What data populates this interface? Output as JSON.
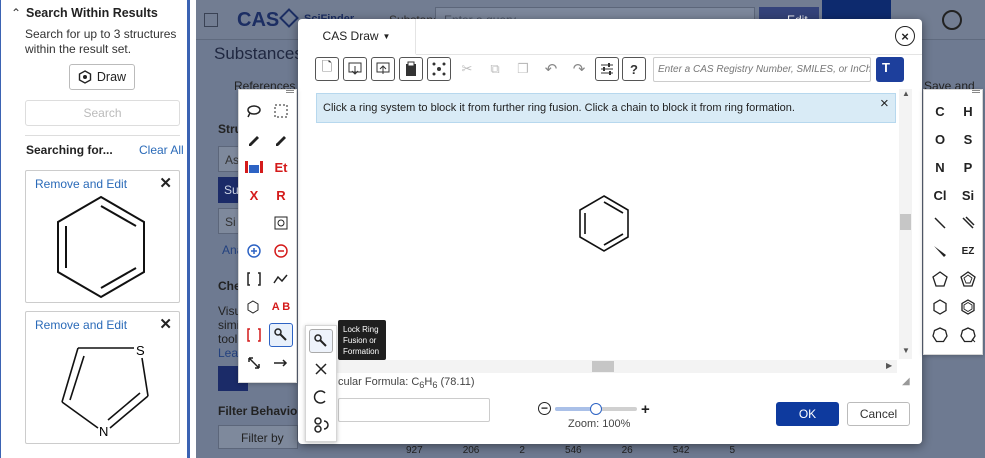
{
  "left": {
    "header": "Search Within Results",
    "desc": "Search for up to 3 structures within the result set.",
    "draw_label": "Draw",
    "search_label": "Search",
    "searching_label": "Searching for...",
    "clear_all": "Clear All",
    "card1_link": "Remove and Edit",
    "card2_link": "Remove and Edit",
    "thiazole_atoms": {
      "s": "S",
      "n": "N"
    }
  },
  "bg": {
    "logo": "CAS",
    "logo_sub": "SciFinder",
    "substances_tab": "Substances",
    "query_placeholder": "Enter a query",
    "edit": "Edit",
    "substance_title": "Substances",
    "references": "References",
    "save_and": "Save and",
    "filter_behavior": "Filter Behavior",
    "filter_by": "Filter by",
    "structure_label": "Stru",
    "che_label": "Che",
    "visu": "Visu",
    "simi": "simi",
    "tool": "tool.",
    "lear": "Lear",
    "ana": "Ana",
    "as": "As",
    "su": "Su",
    "si": "Si",
    "counts": [
      "927",
      "206",
      "2",
      "546",
      "26",
      "542",
      "5"
    ]
  },
  "dialog": {
    "title": "CAS Draw",
    "close": "×",
    "search_placeholder": "Enter a CAS Registry Number, SMILES, or InChI...",
    "info": "Click a ring system to block it from further ring fusion. Click a chain to block it from ring formation.",
    "info_close": "×",
    "formula_label": "cular Formula: C",
    "formula_h": "H",
    "formula_c_sub": "6",
    "formula_h_sub": "6",
    "formula_mass": "(78.11)",
    "zoom_label": "Zoom: 100%",
    "ok": "OK",
    "cancel": "Cancel"
  },
  "palette": {
    "et": "Et",
    "x": "X",
    "r": "R",
    "ab": "A B"
  },
  "tooltip": {
    "line1": "Lock Ring",
    "line2": "Fusion or",
    "line3": "Formation"
  },
  "atoms": {
    "c": "C",
    "h": "H",
    "o": "O",
    "s": "S",
    "n": "N",
    "p": "P",
    "cl": "Cl",
    "si": "Si",
    "ez": "EZ"
  },
  "toolbar_text": {
    "question": "?",
    "t": "T"
  }
}
